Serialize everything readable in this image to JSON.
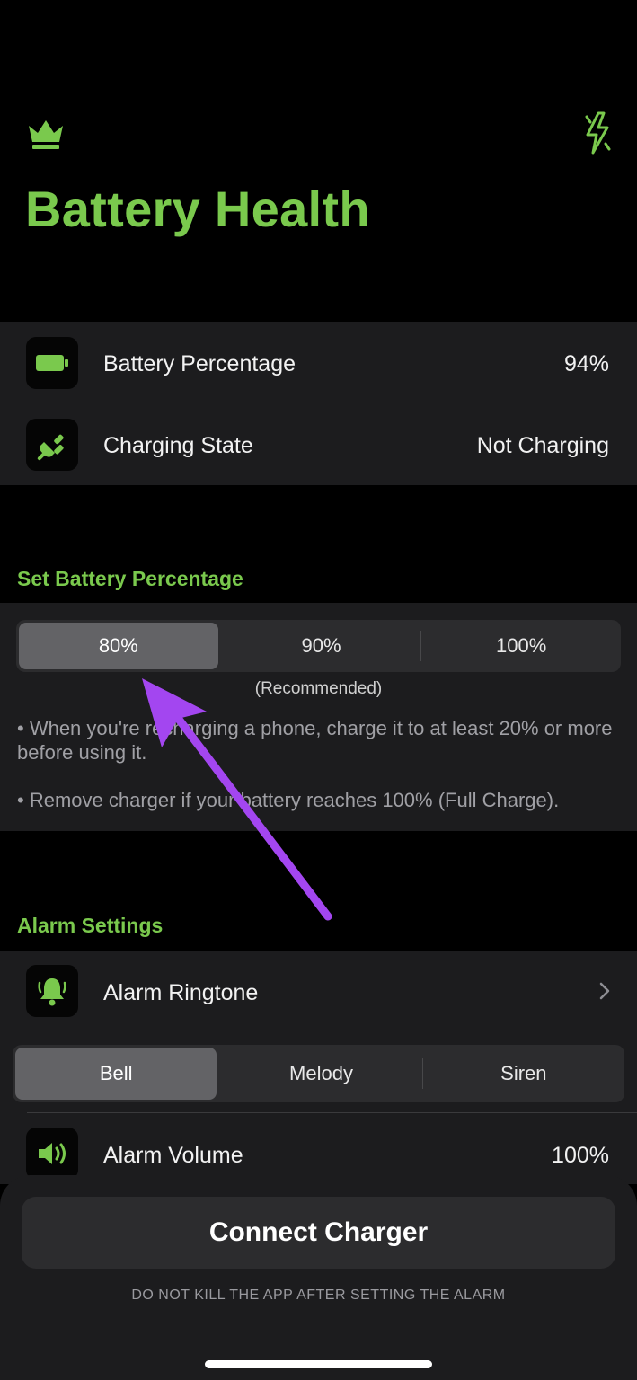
{
  "header": {
    "title": "Battery Health",
    "left_icon": "crown-icon",
    "right_icon": "bolt-icon"
  },
  "status_card": {
    "battery_percentage": {
      "label": "Battery Percentage",
      "value": "94%",
      "icon": "battery-icon"
    },
    "charging_state": {
      "label": "Charging State",
      "value": "Not Charging",
      "icon": "plug-icon"
    }
  },
  "set_battery": {
    "header": "Set Battery Percentage",
    "options": [
      "80%",
      "90%",
      "100%"
    ],
    "selected_index": 0,
    "recommended": "(Recommended)",
    "note_1": "• When you're recharging a phone, charge it to at least 20% or more before using it.",
    "note_2": "• Remove charger if your battery reaches 100% (Full Charge)."
  },
  "alarm": {
    "header": "Alarm Settings",
    "ringtone_label": "Alarm Ringtone",
    "ringtone_options": [
      "Bell",
      "Melody",
      "Siren"
    ],
    "ringtone_selected_index": 0,
    "volume_label": "Alarm Volume",
    "volume_value": "100%"
  },
  "bottom": {
    "connect_label": "Connect Charger",
    "footer_note": "DO NOT KILL THE APP AFTER SETTING THE ALARM"
  },
  "colors": {
    "accent_green": "#7ac94d",
    "annotation_arrow": "#a346f0",
    "background": "#000000",
    "card": "#1c1c1e"
  }
}
